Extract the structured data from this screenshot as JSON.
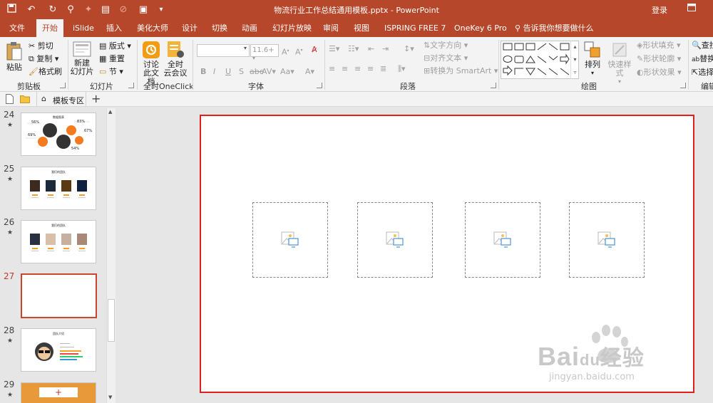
{
  "window": {
    "title": "物流行业工作总结通用模板.pptx - PowerPoint",
    "login": "登录"
  },
  "tabs": [
    "文件",
    "开始",
    "iSlide",
    "插入",
    "美化大师",
    "设计",
    "切换",
    "动画",
    "幻灯片放映",
    "审阅",
    "视图",
    "ISPRING FREE 7",
    "OneKey 6 Pro",
    "告诉我你想要做什么"
  ],
  "ribbon": {
    "clipboard": {
      "label": "剪贴板",
      "paste": "粘贴",
      "cut": "剪切",
      "copy": "复制",
      "format_painter": "格式刷"
    },
    "slides": {
      "label": "幻灯片",
      "new_slide_1": "新建",
      "new_slide_2": "幻灯片",
      "layout": "版式",
      "reset": "重置",
      "section": "节"
    },
    "oneclick": {
      "label": "全时OneClick",
      "discuss_1": "讨论",
      "discuss_2": "此文档",
      "meeting_1": "全时",
      "meeting_2": "云会议"
    },
    "font": {
      "label": "字体",
      "font_size": "11.6+"
    },
    "paragraph": {
      "label": "段落",
      "text_direction": "文字方向",
      "align_text": "对齐文本",
      "smartart": "转换为 SmartArt"
    },
    "drawing": {
      "label": "绘图",
      "arrange": "排列",
      "quick_styles": "快速样式",
      "shape_fill": "形状填充",
      "shape_outline": "形状轮廓",
      "shape_effects": "形状效果"
    },
    "editing": {
      "label": "编辑",
      "find": "查找",
      "replace": "替换",
      "select": "选择"
    }
  },
  "doc_strip": {
    "template_tab": "模板专区"
  },
  "thumbnails": [
    {
      "num": "24",
      "star": "★",
      "title": "数据图表",
      "pct": [
        "56%",
        "83%",
        "69%",
        "67%",
        "54%"
      ]
    },
    {
      "num": "25",
      "star": "★",
      "title": "我们的团队"
    },
    {
      "num": "26",
      "star": "★",
      "title": "我们的团队"
    },
    {
      "num": "27",
      "star": "",
      "title": ""
    },
    {
      "num": "28",
      "star": "★",
      "title": "团队介绍"
    },
    {
      "num": "29",
      "star": "★",
      "title": ""
    }
  ],
  "watermark": {
    "brand": "Bai",
    "brand2": "du",
    "brand3": "经验",
    "url": "jingyan.baidu.com"
  },
  "colors": {
    "accent": "#b7472a",
    "selection": "#e0201c",
    "orange": "#f47b20"
  }
}
